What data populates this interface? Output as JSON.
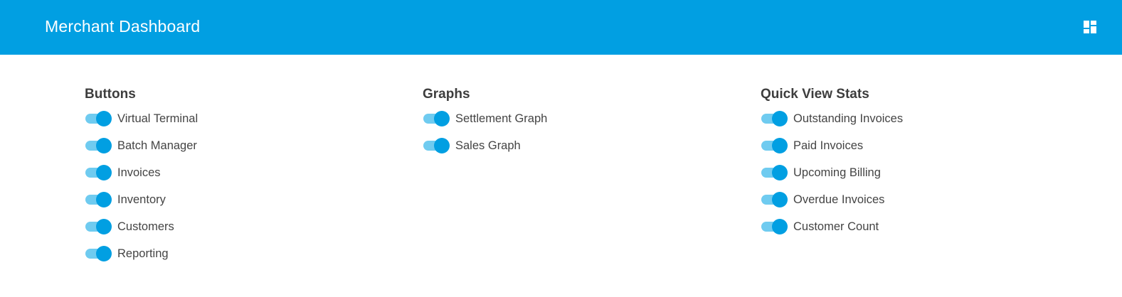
{
  "header": {
    "title": "Merchant Dashboard",
    "layout_icon": "dashboard-layout-icon",
    "background": "#019fe2"
  },
  "colors": {
    "accent": "#019fe2",
    "toggle_track": "#6fcbf0",
    "text": "#444444",
    "heading": "#3d3d3d"
  },
  "sections": {
    "buttons": {
      "title": "Buttons",
      "items": [
        {
          "label": "Virtual Terminal",
          "enabled": true
        },
        {
          "label": "Batch Manager",
          "enabled": true
        },
        {
          "label": "Invoices",
          "enabled": true
        },
        {
          "label": "Inventory",
          "enabled": true
        },
        {
          "label": "Customers",
          "enabled": true
        },
        {
          "label": "Reporting",
          "enabled": true
        }
      ]
    },
    "graphs": {
      "title": "Graphs",
      "items": [
        {
          "label": "Settlement Graph",
          "enabled": true
        },
        {
          "label": "Sales Graph",
          "enabled": true
        }
      ]
    },
    "quick_view_stats": {
      "title": "Quick View Stats",
      "items": [
        {
          "label": "Outstanding Invoices",
          "enabled": true
        },
        {
          "label": "Paid Invoices",
          "enabled": true
        },
        {
          "label": "Upcoming Billing",
          "enabled": true
        },
        {
          "label": "Overdue Invoices",
          "enabled": true
        },
        {
          "label": "Customer Count",
          "enabled": true
        }
      ]
    }
  }
}
